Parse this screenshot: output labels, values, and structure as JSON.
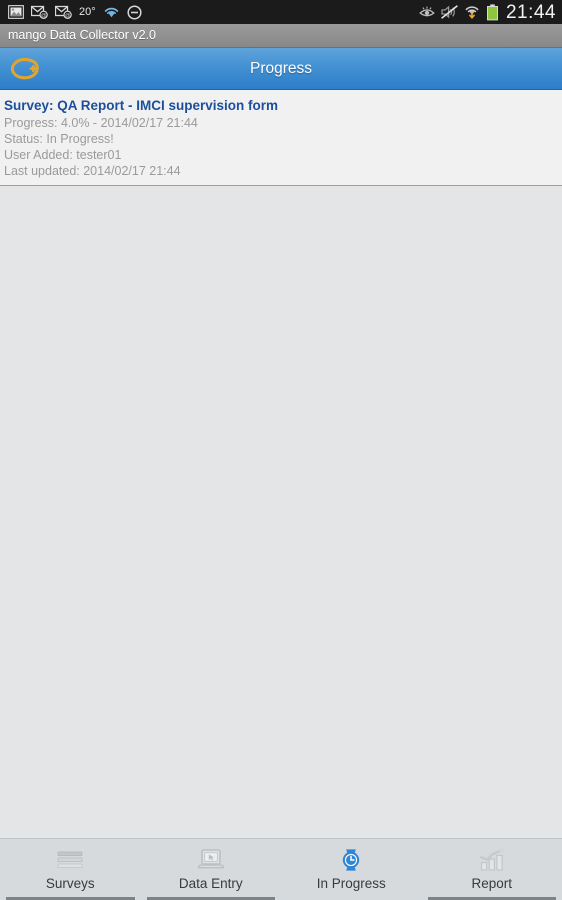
{
  "statusbar": {
    "left_icons": [
      {
        "name": "screenshot-image-icon"
      },
      {
        "name": "email-unread-icon"
      },
      {
        "name": "email-unread-icon-2"
      }
    ],
    "temperature": "20°",
    "wifi_icon": "wifi-icon",
    "dnd_icon": "do-not-disturb-icon",
    "right_icons": [
      {
        "name": "smart-stay-eye-icon"
      },
      {
        "name": "sound-muted-icon"
      },
      {
        "name": "wifi-download-icon"
      },
      {
        "name": "battery-full-icon"
      }
    ],
    "clock": "21:44"
  },
  "titlebar": {
    "app_title": "mango Data Collector v2.0"
  },
  "actionbar": {
    "logo_icon": "mango-add-logo-icon",
    "title": "Progress",
    "accent_top": "#5fa3da",
    "accent_bottom": "#2c7ec9"
  },
  "content": {
    "items": [
      {
        "title": "Survey: QA Report - IMCI supervision form",
        "progress": "Progress: 4.0% - 2014/02/17 21:44",
        "status": "Status: In Progress!",
        "user_added": "User Added: tester01",
        "last_updated": "Last updated: 2014/02/17 21:44",
        "title_color": "#1b4f9c"
      }
    ]
  },
  "tabbar": {
    "tabs": [
      {
        "label": "Surveys",
        "icon": "list-lines-icon",
        "selected": false
      },
      {
        "label": "Data Entry",
        "icon": "laptop-cursor-icon",
        "selected": false
      },
      {
        "label": "In Progress",
        "icon": "watch-clock-icon",
        "selected": true
      },
      {
        "label": "Report",
        "icon": "bar-chart-icon",
        "selected": false
      }
    ],
    "selected_color": "#2f86d4"
  }
}
